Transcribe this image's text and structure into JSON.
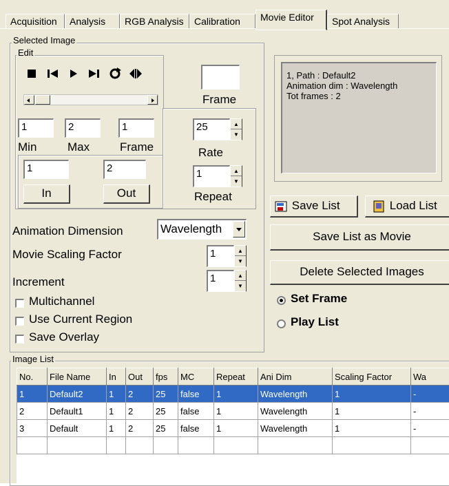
{
  "tabs": [
    {
      "label": "Acquisition",
      "active": false
    },
    {
      "label": "Analysis",
      "active": false
    },
    {
      "label": "RGB Analysis",
      "active": false
    },
    {
      "label": "Calibration",
      "active": false
    },
    {
      "label": "Movie Editor",
      "active": true
    },
    {
      "label": "Spot Analysis",
      "active": false
    }
  ],
  "selected_image": {
    "group_label": "Selected Image",
    "edit_label": "Edit",
    "frame_display_value": "",
    "frame_caption": "Frame",
    "min_value": "1",
    "max_value": "2",
    "frame_value": "1",
    "min_label": "Min",
    "max_label": "Max",
    "frame_label": "Frame",
    "in_value": "1",
    "out_value": "2",
    "in_button": "In",
    "out_button": "Out",
    "rate_value": "25",
    "rate_label": "Rate",
    "repeat_value": "1",
    "repeat_label": "Repeat",
    "animation_dimension_label": "Animation Dimension",
    "animation_dimension_value": "Wavelength",
    "movie_scaling_label": "Movie Scaling Factor",
    "movie_scaling_value": "1",
    "increment_label": "Increment",
    "increment_value": "1",
    "multichannel_label": "Multichannel",
    "use_current_region_label": "Use Current Region",
    "save_overlay_label": "Save Overlay",
    "multichannel_checked": false,
    "use_current_region_checked": false,
    "save_overlay_checked": false
  },
  "info_box": {
    "line1": "1, Path : Default2",
    "line2": "Animation dim : Wavelength",
    "line3": "Tot frames : 2"
  },
  "actions": {
    "save_list": "Save List",
    "load_list": "Load List",
    "save_list_as_movie": "Save List as Movie",
    "delete_selected": "Delete Selected Images",
    "set_frame": "Set Frame",
    "play_list": "Play List",
    "selected_mode": "set_frame"
  },
  "image_list": {
    "group_label": "Image List",
    "columns": [
      "No.",
      "File Name",
      "In",
      "Out",
      "fps",
      "MC",
      "Repeat",
      "Ani Dim",
      "Scaling Factor",
      "Wa"
    ],
    "rows": [
      [
        "1",
        "Default2",
        "1",
        "2",
        "25",
        "false",
        "1",
        "Wavelength",
        "1",
        "-"
      ],
      [
        "2",
        "Default1",
        "1",
        "2",
        "25",
        "false",
        "1",
        "Wavelength",
        "1",
        "-"
      ],
      [
        "3",
        "Default",
        "1",
        "2",
        "25",
        "false",
        "1",
        "Wavelength",
        "1",
        "-"
      ]
    ],
    "selected_row": 0
  },
  "colors": {
    "background": "#ece9d8",
    "selection": "#316ac5"
  }
}
